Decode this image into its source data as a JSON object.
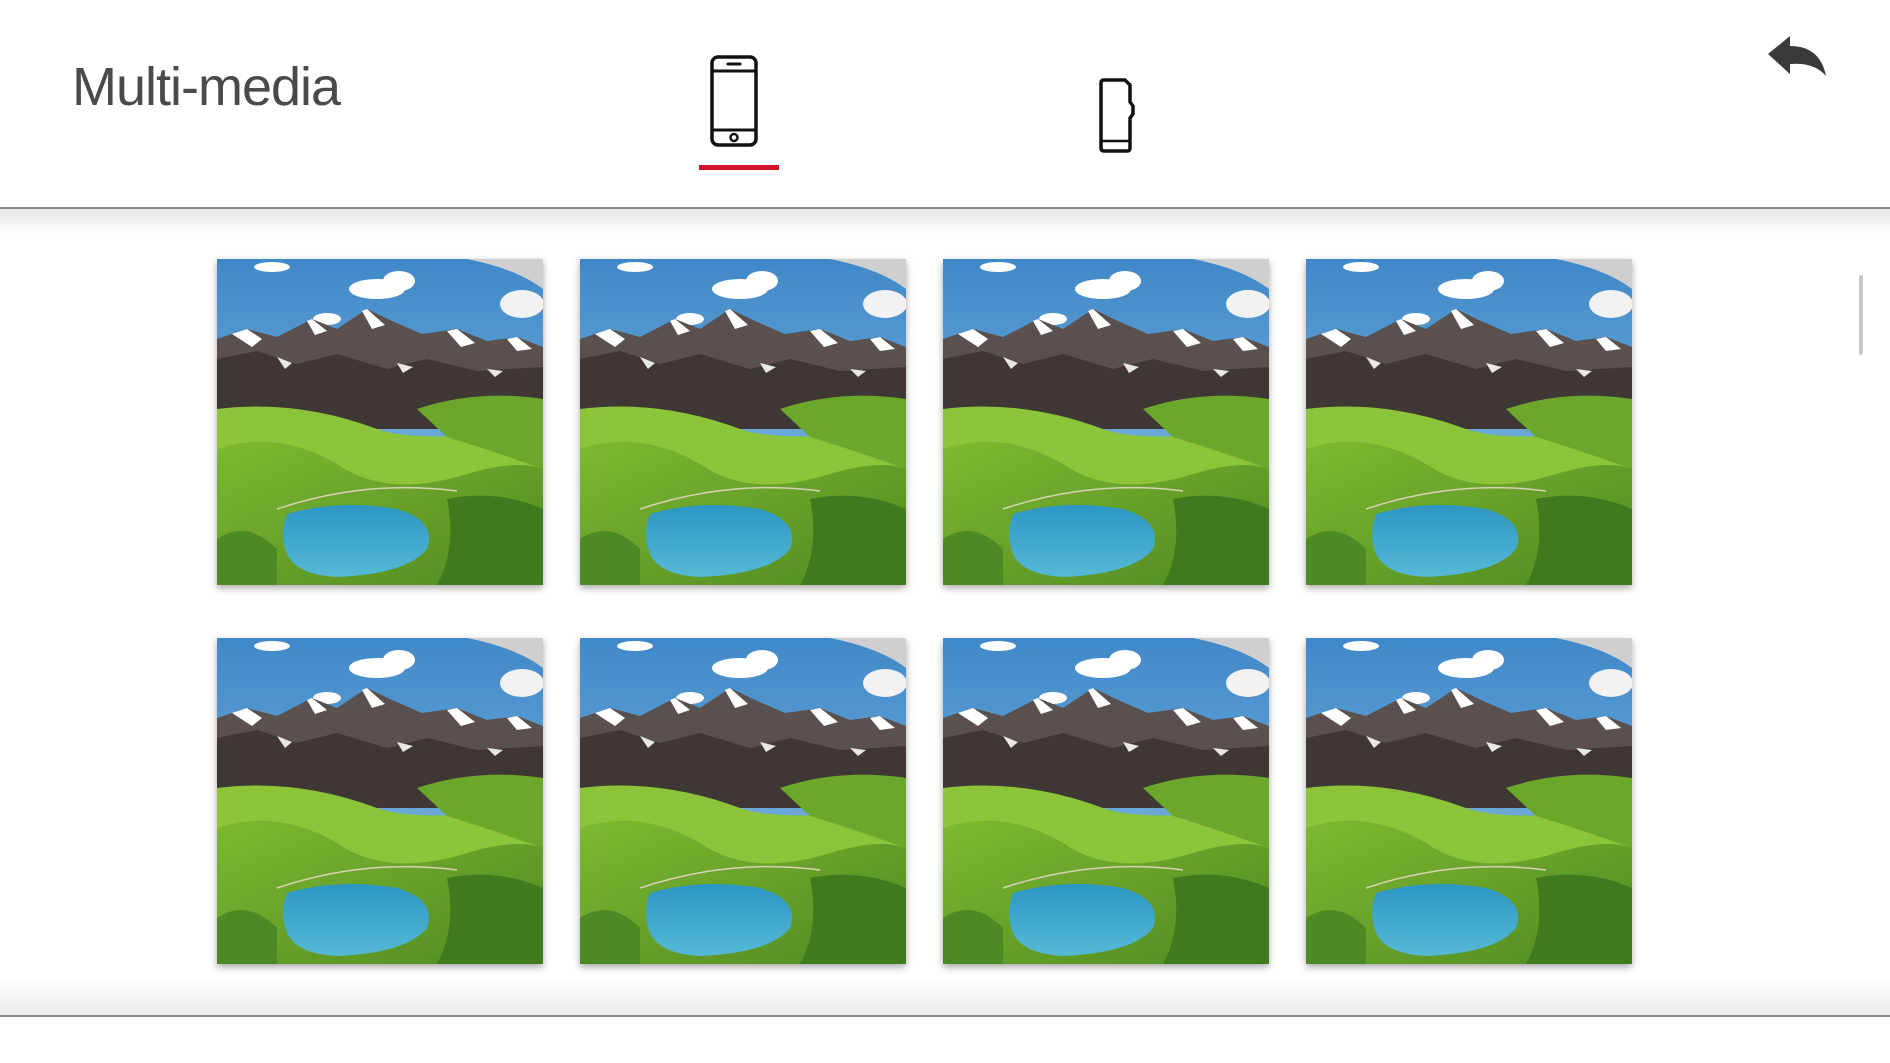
{
  "header": {
    "title": "Multi-media",
    "tabs": [
      {
        "id": "phone",
        "icon": "phone-icon",
        "selected": true
      },
      {
        "id": "sd-card",
        "icon": "sd-card-icon",
        "selected": false
      }
    ],
    "back_icon": "back-arrow-icon",
    "accent_color": "#d0142c"
  },
  "gallery": {
    "items": [
      {
        "type": "image",
        "subject": "mountain-lake-landscape"
      },
      {
        "type": "image",
        "subject": "mountain-lake-landscape"
      },
      {
        "type": "image",
        "subject": "mountain-lake-landscape"
      },
      {
        "type": "image",
        "subject": "mountain-lake-landscape"
      },
      {
        "type": "image",
        "subject": "mountain-lake-landscape"
      },
      {
        "type": "image",
        "subject": "mountain-lake-landscape"
      },
      {
        "type": "image",
        "subject": "mountain-lake-landscape"
      },
      {
        "type": "image",
        "subject": "mountain-lake-landscape"
      }
    ]
  }
}
